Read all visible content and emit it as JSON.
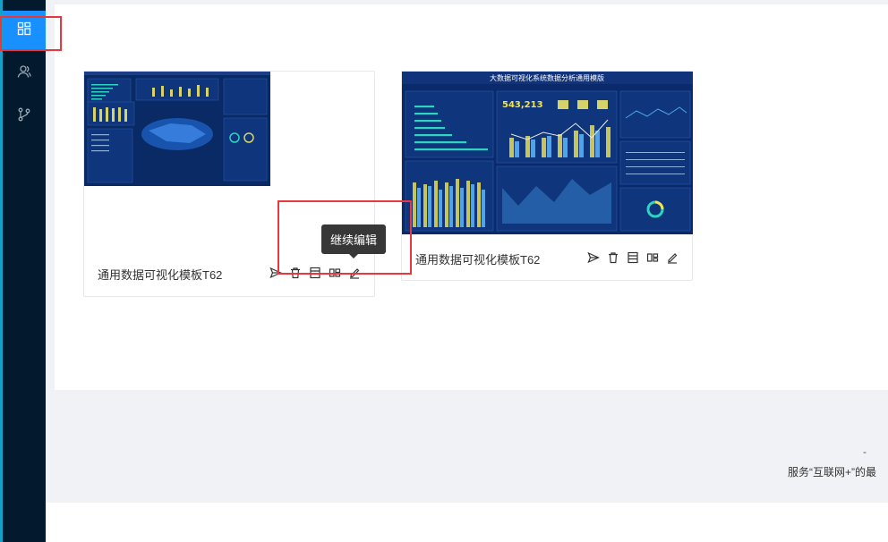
{
  "sidebar": {
    "items": [
      {
        "icon": "dashboard-icon",
        "active": true
      },
      {
        "icon": "users-icon",
        "active": false
      },
      {
        "icon": "branch-icon",
        "active": false
      }
    ]
  },
  "cards": [
    {
      "title": "通用数据可视化模板T62",
      "actions": [
        "publish-icon",
        "delete-icon",
        "template-icon",
        "layout-icon",
        "edit-icon"
      ]
    },
    {
      "title": "通用数据可视化模板T62",
      "thumb_title": "大数据可视化系统数据分析通用模版",
      "thumb_stat": "543,213",
      "actions": [
        "publish-icon",
        "delete-icon",
        "template-icon",
        "layout-icon",
        "edit-icon"
      ]
    }
  ],
  "tooltip": {
    "text": "继续编辑"
  },
  "footer": {
    "dash": "-",
    "text": "服务“互联网+”的最"
  },
  "colors": {
    "sidebar": "#031a2e",
    "accent": "#1890ff",
    "highlight": "#e8383d",
    "thumb_bg": "#0b2a6b"
  }
}
